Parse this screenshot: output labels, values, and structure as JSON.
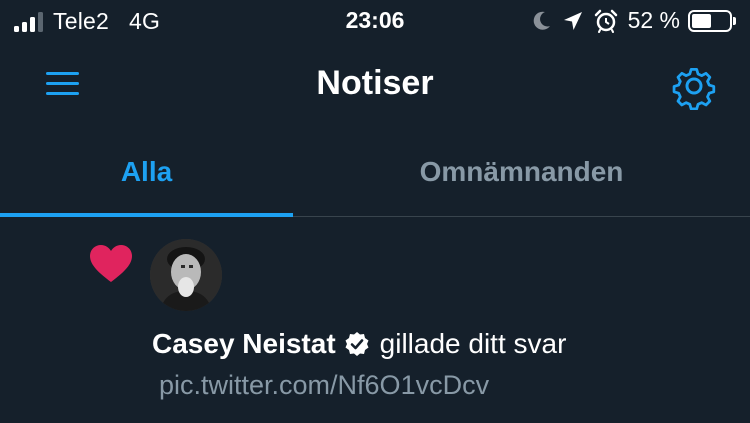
{
  "status_bar": {
    "carrier": "Tele2",
    "network": "4G",
    "time": "23:06",
    "battery_percent": "52 %",
    "battery_level": 0.52,
    "signal_bars_active": 3,
    "signal_bars_total": 4,
    "icons": [
      "moon-icon",
      "location-arrow-icon",
      "alarm-icon"
    ]
  },
  "header": {
    "title": "Notiser",
    "menu_icon": "hamburger-menu-icon",
    "settings_icon": "gear-icon"
  },
  "tabs": [
    {
      "label": "Alla",
      "active": true
    },
    {
      "label": "Omnämnanden",
      "active": false
    }
  ],
  "notifications": [
    {
      "type_icon": "heart-icon",
      "user_name": "Casey Neistat",
      "verified": true,
      "action": "gillade ditt svar",
      "content": "pic.twitter.com/Nf6O1vcDcv"
    }
  ],
  "colors": {
    "background": "#15202b",
    "accent": "#1da1f2",
    "muted_text": "#8899a6",
    "heart": "#e0245e",
    "divider": "#38444d"
  }
}
